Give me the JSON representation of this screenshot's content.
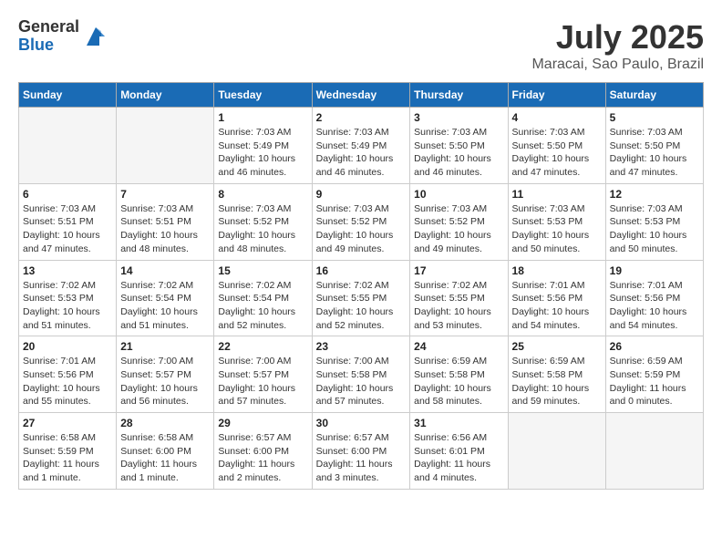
{
  "header": {
    "logo_general": "General",
    "logo_blue": "Blue",
    "title": "July 2025",
    "subtitle": "Maracai, Sao Paulo, Brazil"
  },
  "weekdays": [
    "Sunday",
    "Monday",
    "Tuesday",
    "Wednesday",
    "Thursday",
    "Friday",
    "Saturday"
  ],
  "weeks": [
    [
      null,
      null,
      {
        "day": 1,
        "sunrise": "7:03 AM",
        "sunset": "5:49 PM",
        "daylight": "10 hours and 46 minutes."
      },
      {
        "day": 2,
        "sunrise": "7:03 AM",
        "sunset": "5:49 PM",
        "daylight": "10 hours and 46 minutes."
      },
      {
        "day": 3,
        "sunrise": "7:03 AM",
        "sunset": "5:50 PM",
        "daylight": "10 hours and 46 minutes."
      },
      {
        "day": 4,
        "sunrise": "7:03 AM",
        "sunset": "5:50 PM",
        "daylight": "10 hours and 47 minutes."
      },
      {
        "day": 5,
        "sunrise": "7:03 AM",
        "sunset": "5:50 PM",
        "daylight": "10 hours and 47 minutes."
      }
    ],
    [
      {
        "day": 6,
        "sunrise": "7:03 AM",
        "sunset": "5:51 PM",
        "daylight": "10 hours and 47 minutes."
      },
      {
        "day": 7,
        "sunrise": "7:03 AM",
        "sunset": "5:51 PM",
        "daylight": "10 hours and 48 minutes."
      },
      {
        "day": 8,
        "sunrise": "7:03 AM",
        "sunset": "5:52 PM",
        "daylight": "10 hours and 48 minutes."
      },
      {
        "day": 9,
        "sunrise": "7:03 AM",
        "sunset": "5:52 PM",
        "daylight": "10 hours and 49 minutes."
      },
      {
        "day": 10,
        "sunrise": "7:03 AM",
        "sunset": "5:52 PM",
        "daylight": "10 hours and 49 minutes."
      },
      {
        "day": 11,
        "sunrise": "7:03 AM",
        "sunset": "5:53 PM",
        "daylight": "10 hours and 50 minutes."
      },
      {
        "day": 12,
        "sunrise": "7:03 AM",
        "sunset": "5:53 PM",
        "daylight": "10 hours and 50 minutes."
      }
    ],
    [
      {
        "day": 13,
        "sunrise": "7:02 AM",
        "sunset": "5:53 PM",
        "daylight": "10 hours and 51 minutes."
      },
      {
        "day": 14,
        "sunrise": "7:02 AM",
        "sunset": "5:54 PM",
        "daylight": "10 hours and 51 minutes."
      },
      {
        "day": 15,
        "sunrise": "7:02 AM",
        "sunset": "5:54 PM",
        "daylight": "10 hours and 52 minutes."
      },
      {
        "day": 16,
        "sunrise": "7:02 AM",
        "sunset": "5:55 PM",
        "daylight": "10 hours and 52 minutes."
      },
      {
        "day": 17,
        "sunrise": "7:02 AM",
        "sunset": "5:55 PM",
        "daylight": "10 hours and 53 minutes."
      },
      {
        "day": 18,
        "sunrise": "7:01 AM",
        "sunset": "5:56 PM",
        "daylight": "10 hours and 54 minutes."
      },
      {
        "day": 19,
        "sunrise": "7:01 AM",
        "sunset": "5:56 PM",
        "daylight": "10 hours and 54 minutes."
      }
    ],
    [
      {
        "day": 20,
        "sunrise": "7:01 AM",
        "sunset": "5:56 PM",
        "daylight": "10 hours and 55 minutes."
      },
      {
        "day": 21,
        "sunrise": "7:00 AM",
        "sunset": "5:57 PM",
        "daylight": "10 hours and 56 minutes."
      },
      {
        "day": 22,
        "sunrise": "7:00 AM",
        "sunset": "5:57 PM",
        "daylight": "10 hours and 57 minutes."
      },
      {
        "day": 23,
        "sunrise": "7:00 AM",
        "sunset": "5:58 PM",
        "daylight": "10 hours and 57 minutes."
      },
      {
        "day": 24,
        "sunrise": "6:59 AM",
        "sunset": "5:58 PM",
        "daylight": "10 hours and 58 minutes."
      },
      {
        "day": 25,
        "sunrise": "6:59 AM",
        "sunset": "5:58 PM",
        "daylight": "10 hours and 59 minutes."
      },
      {
        "day": 26,
        "sunrise": "6:59 AM",
        "sunset": "5:59 PM",
        "daylight": "11 hours and 0 minutes."
      }
    ],
    [
      {
        "day": 27,
        "sunrise": "6:58 AM",
        "sunset": "5:59 PM",
        "daylight": "11 hours and 1 minute."
      },
      {
        "day": 28,
        "sunrise": "6:58 AM",
        "sunset": "6:00 PM",
        "daylight": "11 hours and 1 minute."
      },
      {
        "day": 29,
        "sunrise": "6:57 AM",
        "sunset": "6:00 PM",
        "daylight": "11 hours and 2 minutes."
      },
      {
        "day": 30,
        "sunrise": "6:57 AM",
        "sunset": "6:00 PM",
        "daylight": "11 hours and 3 minutes."
      },
      {
        "day": 31,
        "sunrise": "6:56 AM",
        "sunset": "6:01 PM",
        "daylight": "11 hours and 4 minutes."
      },
      null,
      null
    ]
  ]
}
